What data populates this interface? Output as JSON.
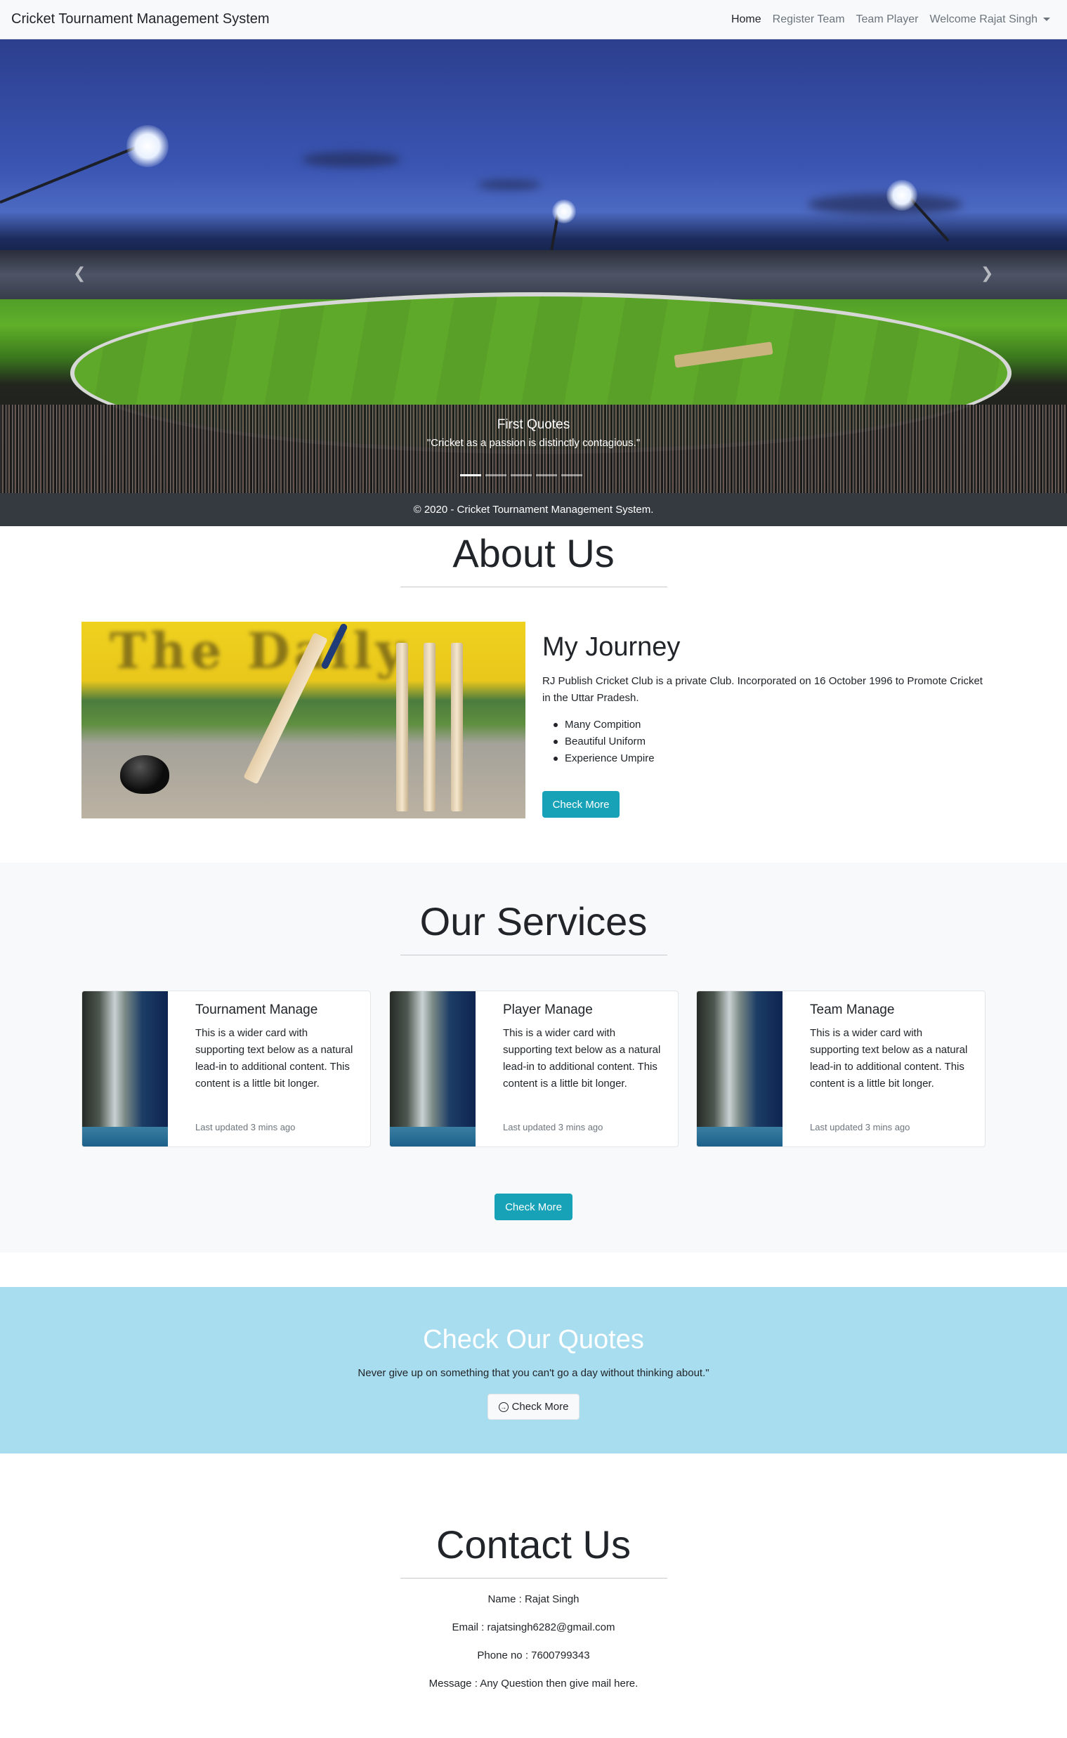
{
  "navbar": {
    "brand": "Cricket Tournament Management System",
    "items": [
      {
        "label": "Home",
        "active": true
      },
      {
        "label": "Register Team"
      },
      {
        "label": "Team Player"
      },
      {
        "label": "Welcome Rajat Singh"
      }
    ]
  },
  "hero": {
    "caption_title": "First Quotes",
    "caption_text": "\"Cricket as a passion is distinctly contagious.\"",
    "prev_icon": "chevron-left-icon",
    "next_icon": "chevron-right-icon"
  },
  "footer_bar": {
    "text": "© 2020 - Cricket Tournament Management System."
  },
  "about": {
    "title": "About Us",
    "heading": "My Journey",
    "text": "RJ Publish Cricket Club is a private Club. Incorporated on 16 October 1996 to Promote Cricket in the Uttar Pradesh.",
    "list": [
      "Many Compition",
      "Beautiful Uniform",
      "Experience Umpire"
    ],
    "button": "Check More"
  },
  "services": {
    "title": "Our Services",
    "cards": [
      {
        "title": "Tournament Manage",
        "text": "This is a wider card with supporting text below as a natural lead-in to additional content. This content is a little bit longer.",
        "muted": "Last updated 3 mins ago"
      },
      {
        "title": "Player Manage",
        "text": "This is a wider card with supporting text below as a natural lead-in to additional content. This content is a little bit longer.",
        "muted": "Last updated 3 mins ago"
      },
      {
        "title": "Team Manage",
        "text": "This is a wider card with supporting text below as a natural lead-in to additional content. This content is a little bit longer.",
        "muted": "Last updated 3 mins ago"
      }
    ],
    "button": "Check More"
  },
  "quotes": {
    "title": "Check Our Quotes",
    "text": "Never give up on something that you can't go a day without thinking about.\"",
    "button": "Check More",
    "button_icon": "arrow-circle-right-icon"
  },
  "contact": {
    "title": "Contact Us",
    "name": "Name : Rajat Singh",
    "email": "Email : rajatsingh6282@gmail.com",
    "phone": "Phone no : 7600799343",
    "message": "Message : Any Question then give mail here."
  },
  "colors": {
    "info": "#17a2b8",
    "footer": "#343a40",
    "quotes_bg": "#a8dcef",
    "navbar_bg": "#f8f9fa"
  }
}
